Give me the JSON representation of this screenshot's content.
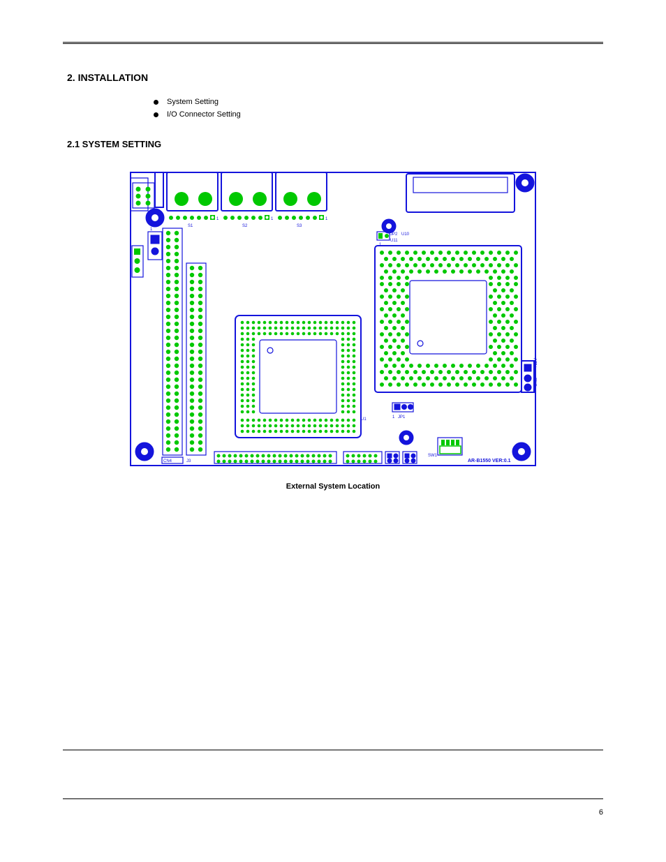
{
  "heading": "2. INSTALLATION",
  "bullets": [
    "System Setting",
    "I/O Connector Setting"
  ],
  "subhead": "2.1 SYSTEM SETTING",
  "caption": "External System Location",
  "page_number": "6",
  "pcb": {
    "board_label": "AR-B1550  VER:0.1",
    "labels": {
      "cn4": "CN4",
      "jp2": "JP2",
      "u10": "U10",
      "u11": "U11",
      "j3": "J3",
      "u1": "U1",
      "jp1": "JP1",
      "sw1": "SW1",
      "plus12v": "+12V",
      "gnd": "GND",
      "one_a": "1",
      "one_b": "1",
      "one_c": "1",
      "one_d": "1",
      "one_e": "1",
      "one_f": "1",
      "lan_a": "S1",
      "lan_b": "S2",
      "lan_c": "S3"
    }
  }
}
